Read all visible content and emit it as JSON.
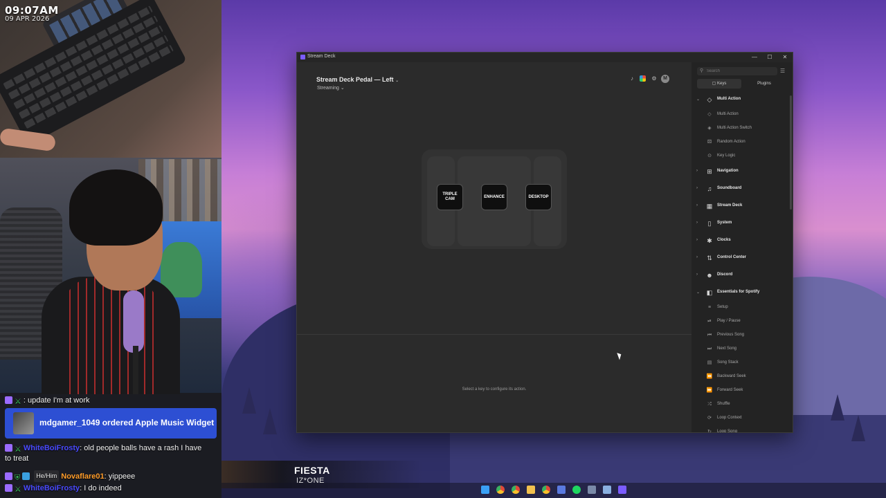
{
  "overlay": {
    "clock_time": "09:07AM",
    "clock_date": "09 APR 2026"
  },
  "chat": {
    "messages": [
      {
        "user": "",
        "text": ": update I'm at work"
      },
      {
        "alert": "mdgamer_1049 ordered Apple Music Widget"
      },
      {
        "user": "WhiteBoiFrosty",
        "text": ": old people balls have a rash I have"
      },
      {
        "continuation": "to treat"
      },
      {
        "pronoun": "He/Him",
        "user": "Novaflare01",
        "text": ": yippeee"
      },
      {
        "user": "WhiteBoiFrosty",
        "text": ": I do indeed"
      }
    ]
  },
  "now_playing": {
    "title": "FIESTA",
    "artist": "IZ*ONE"
  },
  "window": {
    "title": "Stream Deck",
    "controls": {
      "minimize": "—",
      "maximize": "☐",
      "close": "✕"
    },
    "device_name": "Stream Deck Pedal — Left",
    "profile": "Streaming",
    "avatar_letter": "M",
    "pedal_keys": [
      "TRIPLE CAM",
      "ENHANCE",
      "DESKTOP"
    ],
    "hint": "Select a key to configure its action."
  },
  "sidebar": {
    "search_placeholder": "Search",
    "tabs": [
      "Keys",
      "Plugins"
    ],
    "entries": [
      {
        "kind": "category",
        "label": "Multi Action",
        "icon": "multi-action-icon",
        "expanded": true
      },
      {
        "kind": "item",
        "label": "Multi Action",
        "icon": "multi-action-icon"
      },
      {
        "kind": "item",
        "label": "Multi Action Switch",
        "icon": "multi-action-switch-icon"
      },
      {
        "kind": "item",
        "label": "Random Action",
        "icon": "random-action-icon"
      },
      {
        "kind": "item",
        "label": "Key Logic",
        "icon": "key-logic-icon"
      },
      {
        "kind": "category",
        "label": "Navigation",
        "icon": "navigation-icon"
      },
      {
        "kind": "category",
        "label": "Soundboard",
        "icon": "soundboard-icon"
      },
      {
        "kind": "category",
        "label": "Stream Deck",
        "icon": "stream-deck-icon"
      },
      {
        "kind": "category",
        "label": "System",
        "icon": "system-icon"
      },
      {
        "kind": "category",
        "label": "Clocks",
        "icon": "clocks-icon"
      },
      {
        "kind": "category",
        "label": "Control Center",
        "icon": "control-center-icon"
      },
      {
        "kind": "category",
        "label": "Discord",
        "icon": "discord-icon"
      },
      {
        "kind": "category",
        "label": "Essentials for Spotify",
        "icon": "spotify-essentials-icon",
        "expanded": true
      },
      {
        "kind": "item",
        "label": "Setup",
        "icon": "setup-icon"
      },
      {
        "kind": "item",
        "label": "Play / Pause",
        "icon": "play-pause-icon"
      },
      {
        "kind": "item",
        "label": "Previous Song",
        "icon": "previous-song-icon"
      },
      {
        "kind": "item",
        "label": "Next Song",
        "icon": "next-song-icon"
      },
      {
        "kind": "item",
        "label": "Song Stack",
        "icon": "song-stack-icon"
      },
      {
        "kind": "item",
        "label": "Backward Seek",
        "icon": "backward-seek-icon"
      },
      {
        "kind": "item",
        "label": "Forward Seek",
        "icon": "forward-seek-icon"
      },
      {
        "kind": "item",
        "label": "Shuffle",
        "icon": "shuffle-icon"
      },
      {
        "kind": "item",
        "label": "Loop Context",
        "icon": "loop-context-icon"
      },
      {
        "kind": "item",
        "label": "Loop Song",
        "icon": "loop-song-icon"
      }
    ]
  },
  "taskbar": {
    "icons": [
      "windows-start-icon",
      "chrome-icon",
      "chrome-icon",
      "file-explorer-icon",
      "chrome-icon",
      "app-icon",
      "spotify-icon",
      "app-icon",
      "app-icon",
      "stream-deck-icon"
    ]
  },
  "colors": {
    "window_bg": "#2b2b2b",
    "sidebar_bg": "#232323",
    "chat_alert": "#2d4fd3",
    "accent": "#7b5cff"
  }
}
